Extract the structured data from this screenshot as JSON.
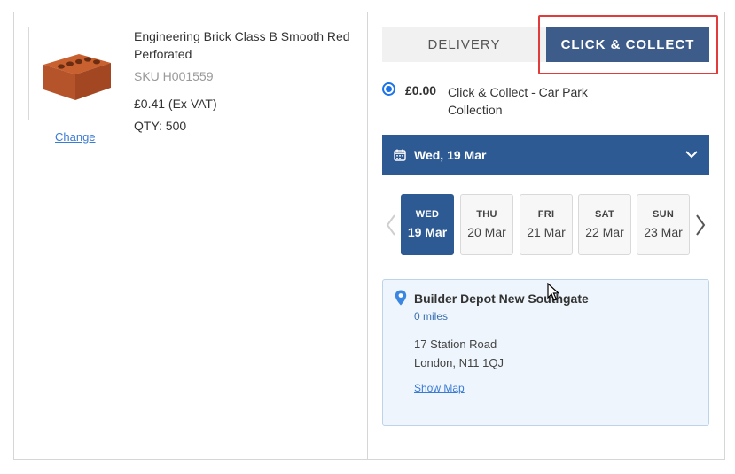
{
  "product": {
    "title": "Engineering Brick Class B Smooth Red Perforated",
    "sku": "SKU H001559",
    "price": "£0.41 (Ex VAT)",
    "qty": "QTY: 500",
    "change_label": "Change",
    "image_icon": "brick-icon"
  },
  "tabs": {
    "delivery_label": "DELIVERY",
    "click_collect_label": "CLICK & COLLECT",
    "active": "click_collect"
  },
  "option": {
    "price": "£0.00",
    "label": "Click & Collect - Car Park Collection",
    "selected": true
  },
  "date_select": {
    "value": "Wed, 19 Mar",
    "icon": "calendar-icon",
    "chevron_icon": "chevron-down-icon"
  },
  "days": [
    {
      "dow": "WED",
      "date": "19 Mar",
      "active": true
    },
    {
      "dow": "THU",
      "date": "20 Mar",
      "active": false
    },
    {
      "dow": "FRI",
      "date": "21 Mar",
      "active": false
    },
    {
      "dow": "SAT",
      "date": "22 Mar",
      "active": false
    },
    {
      "dow": "SUN",
      "date": "23 Mar",
      "active": false
    }
  ],
  "store": {
    "name": "Builder Depot New Southgate",
    "distance": "0 miles",
    "address_line1": "17 Station Road",
    "address_line2": "London, N11 1QJ",
    "map_label": "Show Map",
    "icon": "map-pin-icon"
  },
  "colors": {
    "primary": "#2d5a93",
    "tab_active": "#3d5c8a",
    "highlight": "#e23b3b",
    "link": "#3a7bd5",
    "store_bg": "#eef5fc"
  }
}
